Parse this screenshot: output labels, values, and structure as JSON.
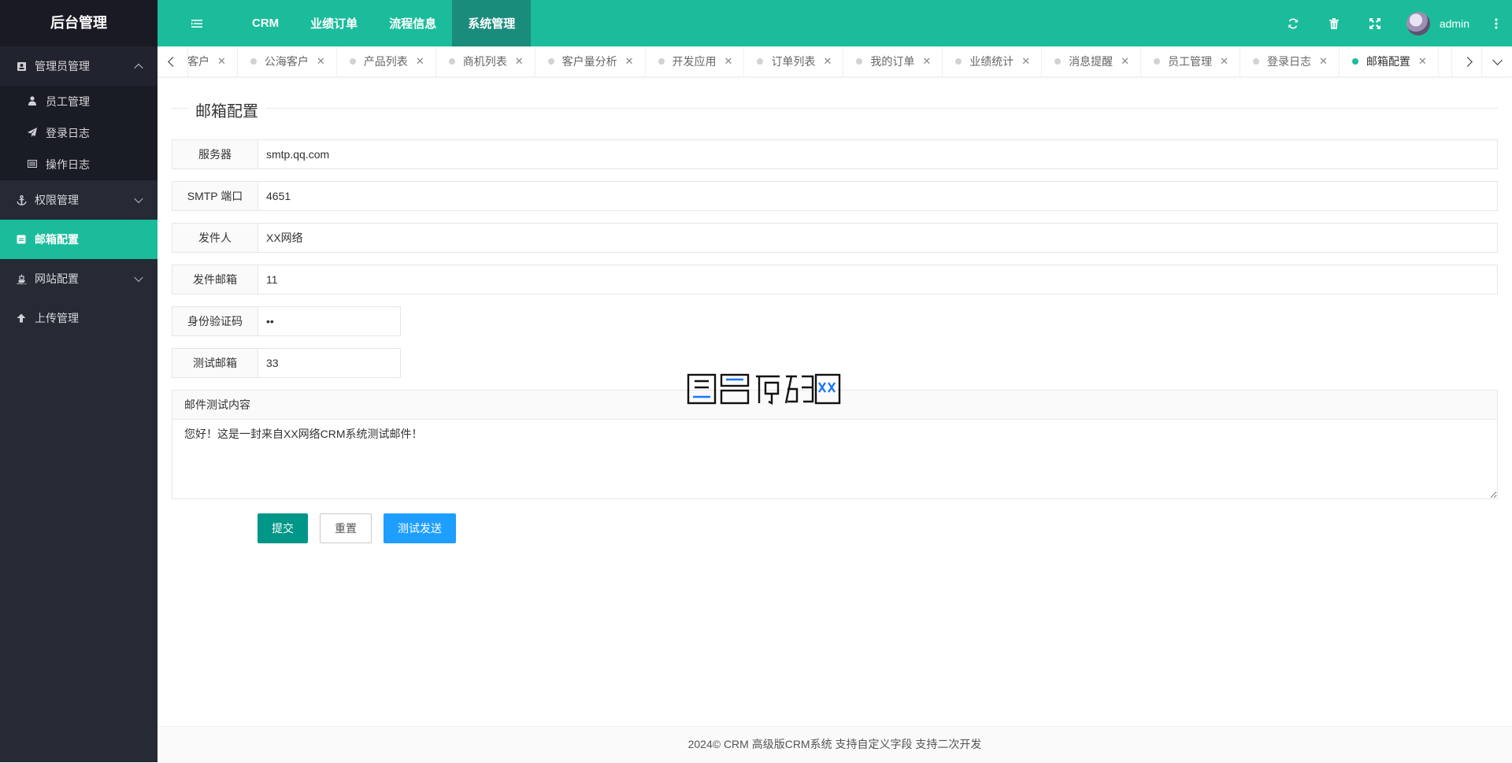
{
  "sidebar": {
    "logo": "后台管理",
    "groups": [
      {
        "label": "管理员管理",
        "icon": "user-card-icon",
        "items": [
          {
            "label": "员工管理",
            "icon": "user-icon"
          },
          {
            "label": "登录日志",
            "icon": "paper-plane-icon"
          },
          {
            "label": "操作日志",
            "icon": "list-icon"
          }
        ]
      },
      {
        "label": "权限管理",
        "icon": "anchor-icon"
      },
      {
        "label": "邮箱配置",
        "icon": "envelope-icon"
      },
      {
        "label": "网站配置",
        "icon": "ship-icon"
      },
      {
        "label": "上传管理",
        "icon": "arrow-up-icon"
      }
    ]
  },
  "header": {
    "nav": [
      "CRM",
      "业绩订单",
      "流程信息",
      "系统管理"
    ],
    "user": "admin"
  },
  "tabs": [
    {
      "label": "客户"
    },
    {
      "label": "公海客户"
    },
    {
      "label": "产品列表"
    },
    {
      "label": "商机列表"
    },
    {
      "label": "客户量分析"
    },
    {
      "label": "开发应用"
    },
    {
      "label": "订单列表"
    },
    {
      "label": "我的订单"
    },
    {
      "label": "业绩统计"
    },
    {
      "label": "消息提醒"
    },
    {
      "label": "员工管理"
    },
    {
      "label": "登录日志"
    },
    {
      "label": "邮箱配置"
    }
  ],
  "form": {
    "title": "邮箱配置",
    "fields": [
      {
        "label": "服务器",
        "value": "smtp.qq.com"
      },
      {
        "label": "SMTP 端口",
        "value": "4651"
      },
      {
        "label": "发件人",
        "value": "XX网络"
      },
      {
        "label": "发件邮箱",
        "value": "11"
      },
      {
        "label": "身份验证码",
        "value": "••"
      },
      {
        "label": "测试邮箱",
        "value": "33"
      }
    ],
    "textarea_label": "邮件测试内容",
    "textarea_value": "您好！这是一封来自XX网络CRM系统测试邮件！",
    "buttons": {
      "submit": "提交",
      "reset": "重置",
      "test": "测试发送"
    }
  },
  "watermark": "图名源码网",
  "footer": "2024© CRM 高级版CRM系统 支持自定义字段 支持二次开发",
  "colors": {
    "accent": "#1bbc9b",
    "sidebar": "#252a35",
    "primary_button": "#009688",
    "test_button": "#1e9fff"
  }
}
